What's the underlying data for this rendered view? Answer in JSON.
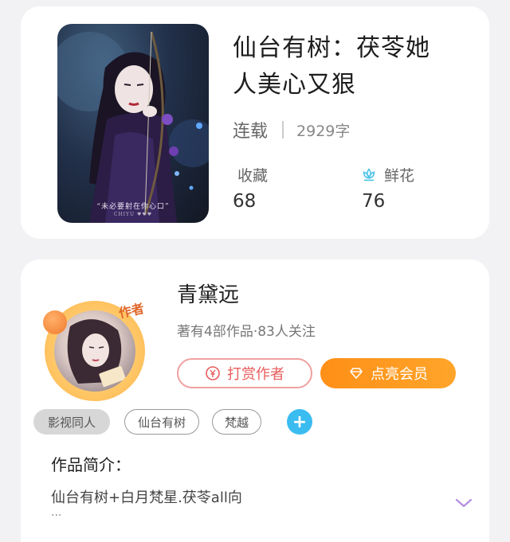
{
  "book": {
    "title_line1": "仙台有树：茯苓她",
    "title_line2": "人美心又狠",
    "status": "连载",
    "word_count": "2929字",
    "cover_caption": "“未必要射在你心口”",
    "cover_sub": "CHIYU ♥♥♥",
    "stats": [
      {
        "label": "收藏",
        "value": "68"
      },
      {
        "label": "鲜花",
        "value": "76",
        "icon": "flower-icon"
      }
    ]
  },
  "author": {
    "name": "青黛远",
    "meta": "著有4部作品·83人关注",
    "badge": "作者",
    "tip_button": "打赏作者",
    "vip_button": "点亮会员"
  },
  "tags": [
    "影视同人",
    "仙台有树",
    "梵越"
  ],
  "add_tag_label": "+",
  "intro": {
    "heading": "作品简介：",
    "text": "仙台有树+白月梵星.茯苓all向",
    "ellipsis": "..."
  },
  "colors": {
    "accent_orange": "#ff9a1f",
    "tip_red": "#e85c5c",
    "flower_blue": "#4cc3e8",
    "tag_add_blue": "#3bbcf0",
    "expand_purple": "#b38ee0"
  }
}
